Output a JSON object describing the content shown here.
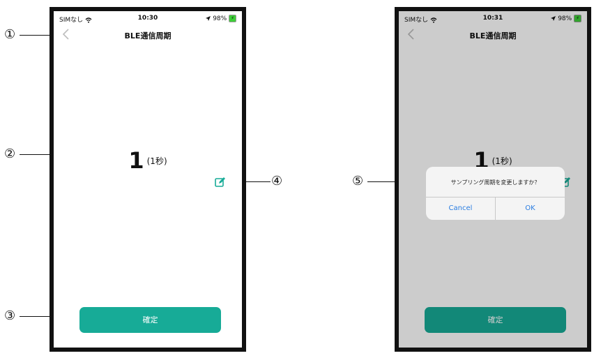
{
  "callouts": [
    "①",
    "②",
    "③",
    "④",
    "⑤"
  ],
  "left_screen": {
    "status": {
      "carrier": "SIMなし",
      "time": "10:30",
      "battery": "98%"
    },
    "title": "BLE通信周期",
    "value": "1",
    "unit": "(1秒)",
    "confirm_label": "確定"
  },
  "right_screen": {
    "status": {
      "carrier": "SIMなし",
      "time": "10:31",
      "battery": "98%"
    },
    "title": "BLE通信周期",
    "value": "1",
    "unit": "(1秒)",
    "confirm_label": "確定",
    "alert": {
      "message": "サンプリング周期を変更しますか？",
      "cancel": "Cancel",
      "ok": "OK"
    }
  },
  "colors": {
    "accent": "#17ab97",
    "link": "#2a7de1",
    "back_icon": "#bdbdbd"
  },
  "icons": [
    "chevron-left-icon",
    "wifi-icon",
    "location-arrow-icon",
    "battery-icon",
    "edit-icon"
  ]
}
